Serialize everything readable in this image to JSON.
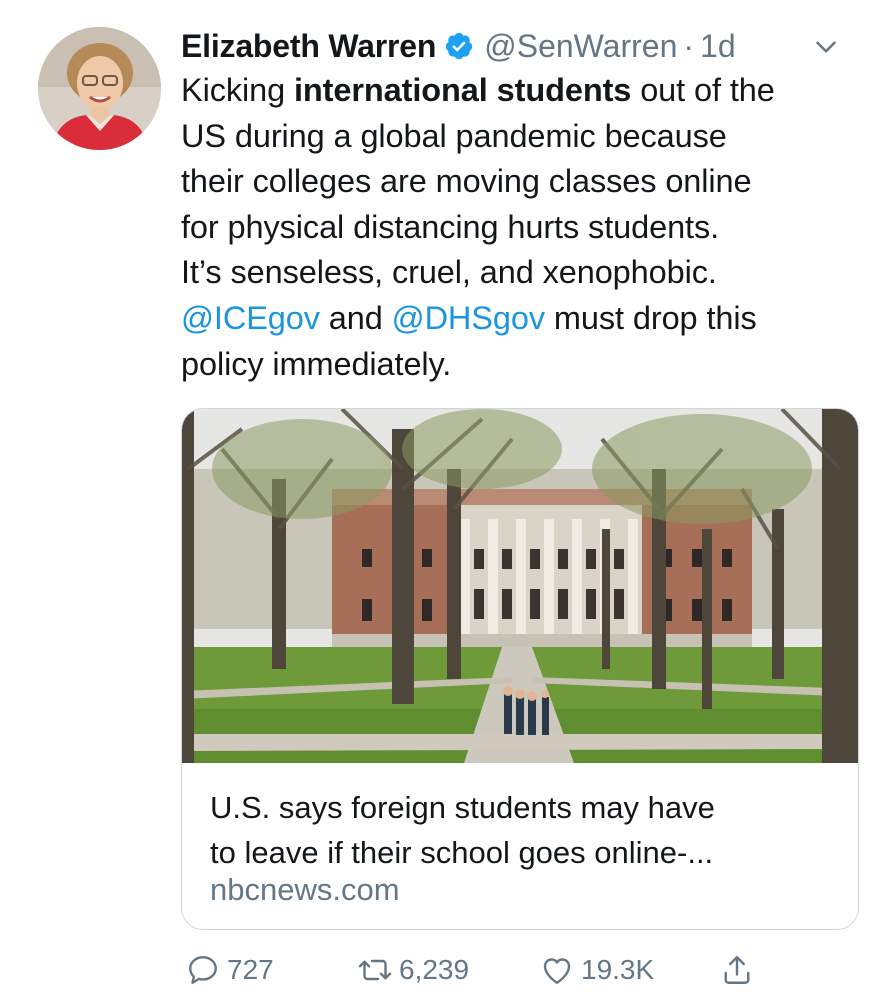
{
  "author": {
    "name": "Elizabeth Warren",
    "handle": "@SenWarren",
    "separator": "·",
    "time": "1d"
  },
  "icons": {
    "verified": "verified-badge-icon",
    "caret": "chevron-down-icon",
    "reply": "reply-icon",
    "retweet": "retweet-icon",
    "like": "heart-icon",
    "share": "share-icon"
  },
  "colors": {
    "text": "#14171a",
    "secondary": "#657786",
    "mention": "#1b95e0",
    "verified": "#1da1f2",
    "border": "#ccd6dd"
  },
  "tweet": {
    "l1_a": "Kicking ",
    "l1_bold": "international students",
    "l1_b": " out of the",
    "l2": "US during a global pandemic because",
    "l3": "their colleges are moving classes online",
    "l4": "for physical distancing hurts students.",
    "l5": "It’s senseless, cruel, and xenophobic.",
    "l6_mention1": "@ICEgov",
    "l6_mid": " and ",
    "l6_mention2": "@DHSgov",
    "l6_b": " must drop this",
    "l7": "policy immediately."
  },
  "card": {
    "title_line1": "U.S. says foreign students may have",
    "title_line2": "to leave if their school goes online-...",
    "domain": "nbcnews.com"
  },
  "stats": {
    "replies": "727",
    "retweets": "6,239",
    "likes": "19.3K"
  }
}
